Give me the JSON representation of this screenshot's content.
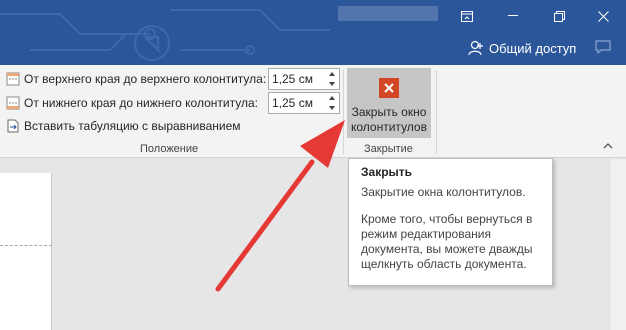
{
  "titlebar": {
    "share_label": "Общий доступ",
    "icons": [
      "ribbon-display-icon",
      "minimize-icon",
      "restore-icon",
      "close-icon",
      "user-icon",
      "comment-icon"
    ]
  },
  "ribbon": {
    "position_group": {
      "label": "Положение",
      "header_row": {
        "label": "От верхнего края до верхнего колонтитула:",
        "value": "1,25 см"
      },
      "footer_row": {
        "label": "От нижнего края до нижнего колонтитула:",
        "value": "1,25 см"
      },
      "tab_row": {
        "label": "Вставить табуляцию с выравниванием"
      }
    },
    "close_group": {
      "label": "Закрытие",
      "button_line1": "Закрыть окно",
      "button_line2": "колонтитулов"
    }
  },
  "tooltip": {
    "title": "Закрыть",
    "line1": "Закрытие окна колонтитулов.",
    "body": "Кроме того, чтобы вернуться в режим редактирования документа, вы можете дважды щелкнуть область документа."
  },
  "colors": {
    "titlebar": "#2b579a",
    "close_icon": "#d24726",
    "arrow": "#e53935"
  }
}
